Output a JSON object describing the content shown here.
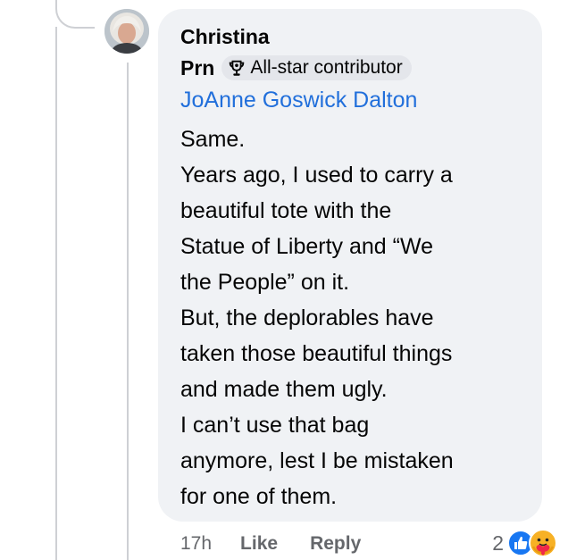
{
  "comment": {
    "author_first": "Christina",
    "author_last": "Prn",
    "badge_label": "All-star contributor",
    "mention": "JoAnne Goswick Dalton",
    "body_lines": [
      "Same.",
      "Years ago, I used to carry a",
      "beautiful tote with the",
      "Statue of Liberty and “We",
      "the People” on it.",
      "But, the deplorables have",
      "taken those beautiful things",
      "and made them ugly.",
      "I can’t use that bag",
      "anymore, lest I be mistaken",
      "for one of them."
    ],
    "timestamp": "17h",
    "like_label": "Like",
    "reply_label": "Reply",
    "reaction_count": "2",
    "reaction_icons": [
      "like-reaction-icon",
      "care-reaction-icon"
    ]
  },
  "colors": {
    "bubble_bg": "#f0f2f5",
    "mention": "#216fdb",
    "secondary_text": "#65676b",
    "like_blue": "#1877f2",
    "care_yellow": "#f7b125"
  }
}
